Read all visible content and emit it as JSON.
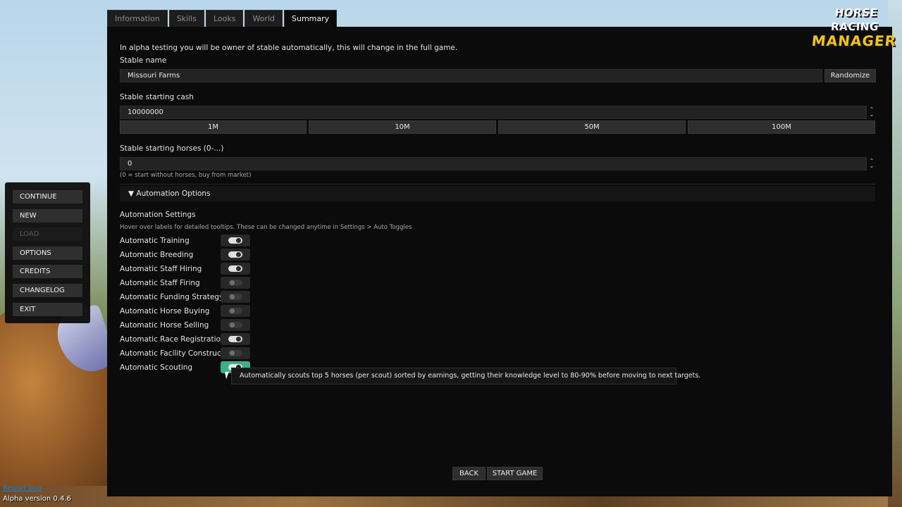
{
  "logo": {
    "line1": "HORSE RACING",
    "line2": "MANAGER"
  },
  "tabs": [
    {
      "label": "Information",
      "active": false
    },
    {
      "label": "Skills",
      "active": false
    },
    {
      "label": "Looks",
      "active": false
    },
    {
      "label": "World",
      "active": false
    },
    {
      "label": "Summary",
      "active": true
    }
  ],
  "summary": {
    "notice": "In alpha testing you will be owner of stable automatically, this will change in the full game.",
    "stable_name_label": "Stable name",
    "stable_name_value": "Missouri Farms",
    "randomize_label": "Randomize",
    "cash_label": "Stable starting cash",
    "cash_value": "10000000",
    "cash_presets": [
      "1M",
      "10M",
      "50M",
      "100M"
    ],
    "horses_label": "Stable starting horses (0-...)",
    "horses_value": "0",
    "horses_hint": "(0 = start without horses, buy from market)",
    "automation_header": "▼ Automation Options",
    "automation_title": "Automation Settings",
    "automation_hint": "Hover over labels for detailed tooltips. These can be changed anytime in Settings > Auto Toggles",
    "toggles": [
      {
        "label": "Automatic Training",
        "state": "on"
      },
      {
        "label": "Automatic Breeding",
        "state": "on"
      },
      {
        "label": "Automatic Staff Hiring",
        "state": "on"
      },
      {
        "label": "Automatic Staff Firing",
        "state": "off"
      },
      {
        "label": "Automatic Funding Strategy",
        "state": "off"
      },
      {
        "label": "Automatic Horse Buying",
        "state": "off"
      },
      {
        "label": "Automatic Horse Selling",
        "state": "off"
      },
      {
        "label": "Automatic Race Registration",
        "state": "on"
      },
      {
        "label": "Automatic Facility Construction",
        "state": "off"
      },
      {
        "label": "Automatic Scouting",
        "state": "on-hover"
      }
    ],
    "tooltip": "Automatically scouts top 5 horses (per scout) sorted by earnings, getting their knowledge level to 80-90% before moving to next targets.",
    "back_label": "BACK",
    "start_label": "START GAME"
  },
  "menu": {
    "items": [
      {
        "label": "CONTINUE",
        "enabled": true
      },
      {
        "label": "NEW",
        "enabled": true
      },
      {
        "label": "LOAD",
        "enabled": false
      },
      {
        "label": "OPTIONS",
        "enabled": true
      },
      {
        "label": "CREDITS",
        "enabled": true
      },
      {
        "label": "CHANGELOG",
        "enabled": true
      },
      {
        "label": "EXIT",
        "enabled": true
      }
    ]
  },
  "footer": {
    "report_bug": "Report bug",
    "version": "Alpha version 0.4.6"
  },
  "colors": {
    "accent_green": "#3cb08b",
    "logo_yellow": "#f4c21c",
    "link_blue": "#1e7fd6"
  }
}
